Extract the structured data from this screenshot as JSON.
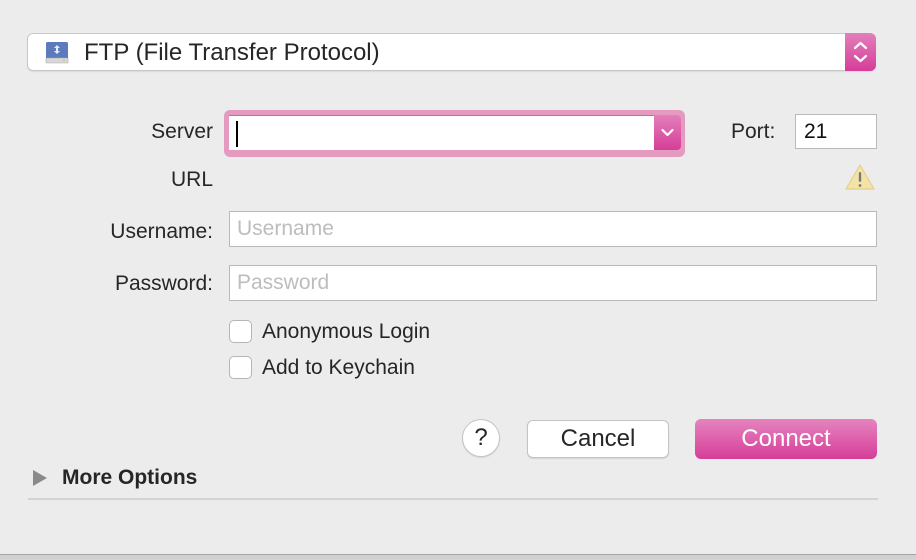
{
  "protocol": {
    "selected": "FTP (File Transfer Protocol)",
    "icon": "network-drive-icon"
  },
  "server": {
    "label": "Server",
    "value": "",
    "accent_color": "#d63d98"
  },
  "url": {
    "label": "URL"
  },
  "port": {
    "label": "Port:",
    "value": "21"
  },
  "warning": {
    "icon": "warning-icon"
  },
  "username": {
    "label": "Username:",
    "placeholder": "Username",
    "value": ""
  },
  "password": {
    "label": "Password:",
    "placeholder": "Password",
    "value": ""
  },
  "options": [
    {
      "label": "Anonymous Login",
      "checked": false
    },
    {
      "label": "Add to Keychain",
      "checked": false
    }
  ],
  "buttons": {
    "help": "?",
    "cancel": "Cancel",
    "connect": "Connect"
  },
  "more_options": {
    "label": "More Options",
    "expanded": false
  }
}
